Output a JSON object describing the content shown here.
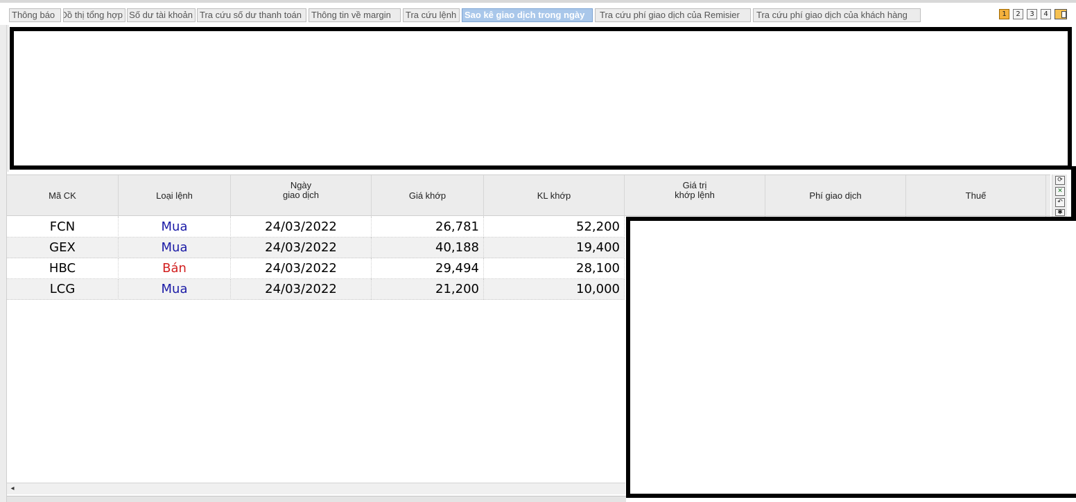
{
  "tabs": [
    {
      "label": "Thông báo"
    },
    {
      "label": "Đồ thị tổng hợp"
    },
    {
      "label": "Số dư tài khoản"
    },
    {
      "label": "Tra cứu số dư thanh toán"
    },
    {
      "label": "Thông tin về margin"
    },
    {
      "label": "Tra cứu lệnh"
    },
    {
      "label": "Sao kê giao dịch trong ngày"
    },
    {
      "label": "Tra cứu phí giao dịch của Remisier"
    },
    {
      "label": "Tra cứu phí giao dịch của khách hàng"
    }
  ],
  "active_tab": "Sao kê giao dịch trong ngày",
  "page_buttons": [
    "1",
    "2",
    "3",
    "4"
  ],
  "active_page": "1",
  "grid": {
    "columns": {
      "ma_ck": "Mã CK",
      "loai_lenh": "Loại lệnh",
      "ngay_gd_1": "Ngày",
      "ngay_gd_2": "giao dịch",
      "gia_khop": "Giá khớp",
      "kl_khop": "KL khớp",
      "gia_tri_1": "Giá trị",
      "gia_tri_2": "khớp lệnh",
      "phi_gd": "Phí giao dịch",
      "thue": "Thuế"
    },
    "rows": [
      {
        "ma_ck": "FCN",
        "loai_lenh": "Mua",
        "ngay": "24/03/2022",
        "gia_khop": "26,781",
        "kl_khop": "52,200"
      },
      {
        "ma_ck": "GEX",
        "loai_lenh": "Mua",
        "ngay": "24/03/2022",
        "gia_khop": "40,188",
        "kl_khop": "19,400"
      },
      {
        "ma_ck": "HBC",
        "loai_lenh": "Bán",
        "ngay": "24/03/2022",
        "gia_khop": "29,494",
        "kl_khop": "28,100"
      },
      {
        "ma_ck": "LCG",
        "loai_lenh": "Mua",
        "ngay": "24/03/2022",
        "gia_khop": "21,200",
        "kl_khop": "10,000"
      }
    ]
  },
  "colors": {
    "buy": "#1a1aa6",
    "sell": "#d21f1f",
    "active_tab": "#a9c7ea",
    "active_page": "#f4b13c"
  },
  "icons": {
    "tools": [
      "refresh-icon",
      "excel-export-icon",
      "undo-icon",
      "star-icon"
    ],
    "scroll_left": "◂"
  }
}
